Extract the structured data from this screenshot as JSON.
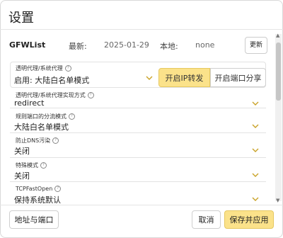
{
  "dialog": {
    "title": "设置"
  },
  "gfwlist": {
    "label": "GFWList",
    "latest_key": "最新:",
    "latest_value": "2025-01-29",
    "local_key": "本地:",
    "local_value": "none",
    "update_label": "更新"
  },
  "fields": [
    {
      "label": "透明代理/系统代理",
      "value": "启用: 大陆白名单模式"
    },
    {
      "label": "透明代理/系统代理实现方式",
      "value": "redirect"
    },
    {
      "label": "规则端口的分流模式",
      "value": "大陆白名单模式"
    },
    {
      "label": "防止DNS污染",
      "value": "关闭"
    },
    {
      "label": "特殊模式",
      "value": "关闭"
    },
    {
      "label": "TCPFastOpen",
      "value": "保持系统默认"
    }
  ],
  "proxy_buttons": {
    "ip_forward": "开启IP转发",
    "port_share": "开启端口分享"
  },
  "footer": {
    "address_port": "地址与端口",
    "cancel": "取消",
    "save_apply": "保存并应用"
  },
  "colors": {
    "accent": "#fbe28a",
    "chevron": "#c9a227"
  }
}
